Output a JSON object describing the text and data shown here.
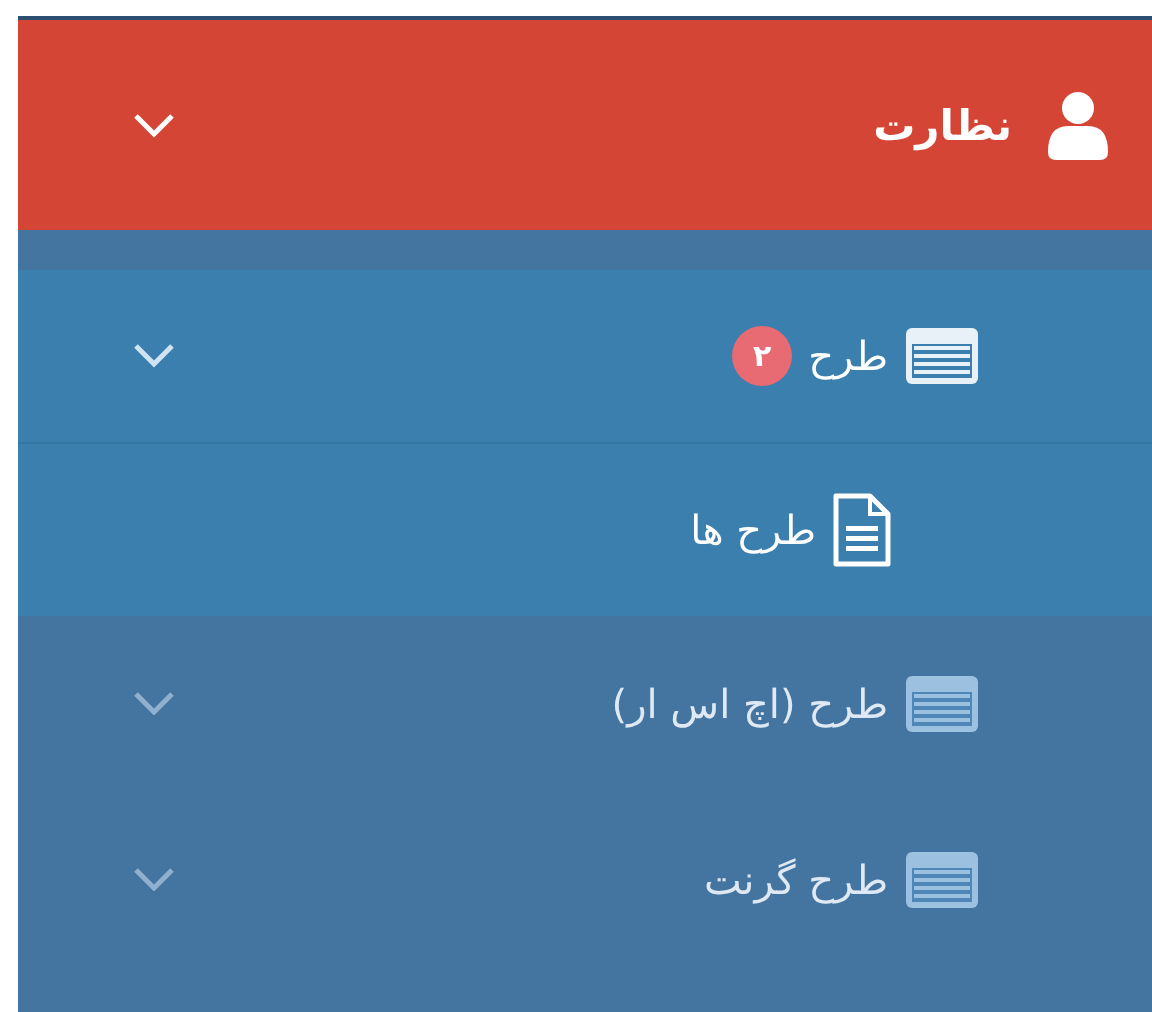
{
  "header": {
    "label": "نظارت",
    "expanded": true
  },
  "menu": [
    {
      "label": "طرح",
      "badge": "۲",
      "expanded": true,
      "children": [
        {
          "label": "طرح ها"
        }
      ]
    },
    {
      "label": "طرح (اچ اس ار)",
      "expanded": false
    },
    {
      "label": "طرح گرنت",
      "expanded": false
    }
  ]
}
